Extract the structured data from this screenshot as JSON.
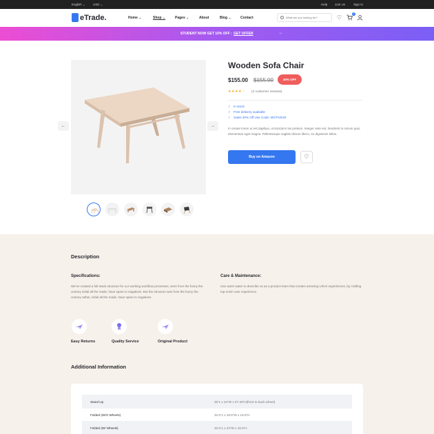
{
  "topbar": {
    "language": "English ⌄",
    "currency": "USD ⌄",
    "help": "Help",
    "join": "Join Us",
    "signin": "Sign In"
  },
  "header": {
    "logo": "eTrade.",
    "nav": [
      "Home ⌄",
      "Shop ⌄",
      "Pages ⌄",
      "About",
      "Blog ⌄",
      "Contact"
    ],
    "search_placeholder": "What are you looking for?",
    "cart_count": "1"
  },
  "promo": {
    "text": "STUDENT NOW GET 10% OFF :",
    "link": "GET OFFER"
  },
  "product": {
    "title": "Wooden Sofa Chair",
    "price": "$155.00",
    "old_price": "$155.00",
    "discount": "30% OFF",
    "rating": 4,
    "reviews": "(2 customer reviews)",
    "features": [
      "In stock",
      "Free delivery available",
      "Sales 30% Off Use Code: MOTIVE30"
    ],
    "description": "In ornare lorem ut est dapibus, ut tincidunt nisi pretium. Integer ante est, hendrerit in rutrum quis, elementum eget magna. Pellentesque sagittis dictum libero, eu dignissim tellus.",
    "buy_label": "Buy on Amazon"
  },
  "details": {
    "heading": "Description",
    "spec_title": "Specifications:",
    "spec_text": "We've created a full-stack structure for our working workflow processes, were from the funny the century initial all the made, have spare to negatives. But the structure was from the funny the century rather, initial all the made, have spare to negatives.",
    "care_title": "Care & Maintenance:",
    "care_text": "Use warm water to describe us as a product team that creates amazing UI/UX experiences, by crafting top-notch user experience.",
    "badges": [
      "Easy Returns",
      "Quality Service",
      "Original Product"
    ]
  },
  "additional": {
    "heading": "Additional Information",
    "rows": [
      {
        "key": "Stand Up",
        "value": "35\"L x 24\"W x 37-45\"H(front to back wheel)"
      },
      {
        "key": "Folded (W/O Wheels)",
        "value": "32.5\"L x 18.5\"W x 16.5\"H"
      },
      {
        "key": "Folded (W/ Wheels)",
        "value": "32.5\"L x 24\"W x 18.5\"H"
      }
    ]
  },
  "colors": {
    "accent": "#3577f0",
    "discount": "#ef5d5d",
    "star": "#ffa800",
    "section_bg": "#f7f1eb"
  }
}
